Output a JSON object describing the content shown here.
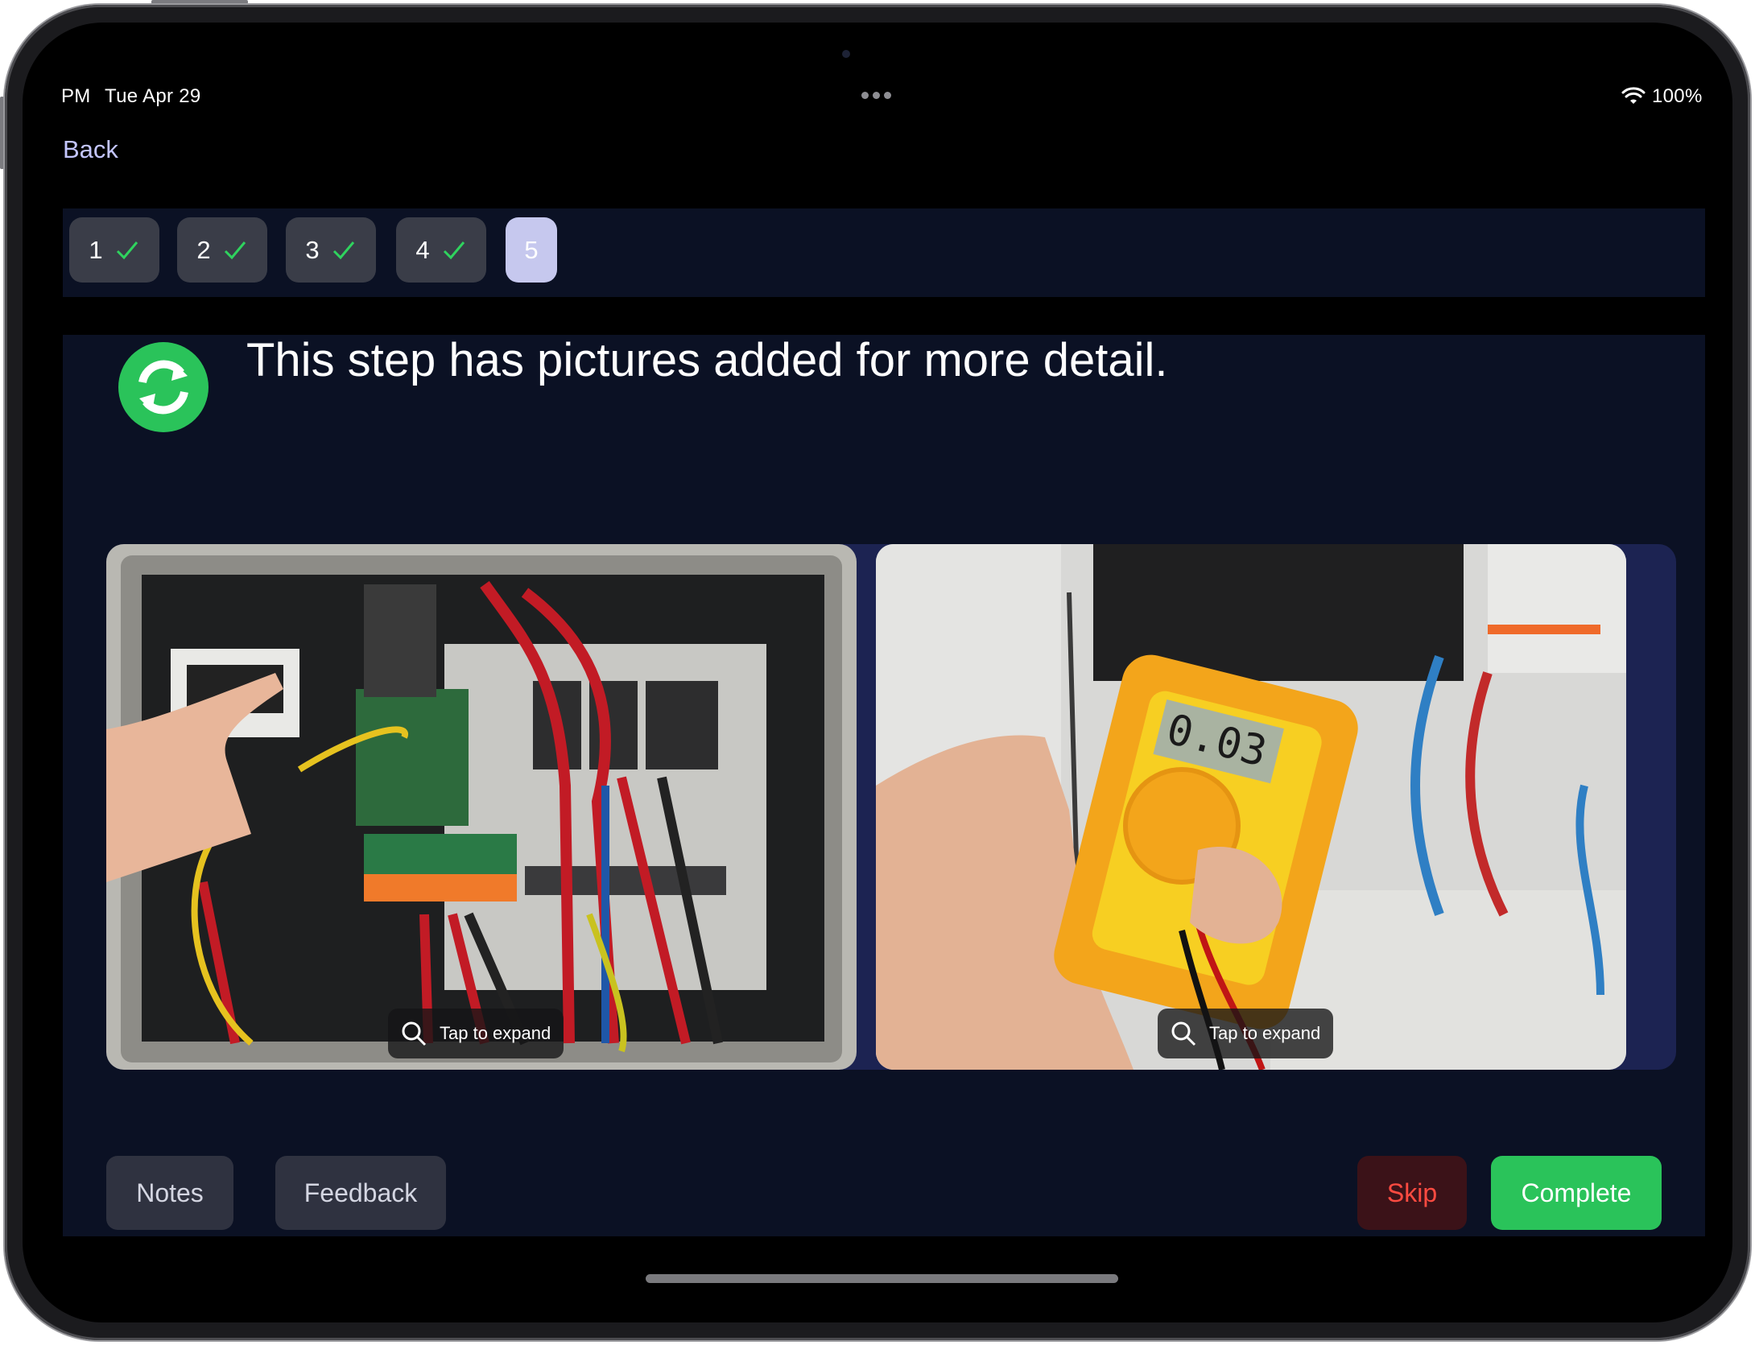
{
  "status_bar": {
    "time": "PM",
    "date": "Tue Apr 29",
    "battery": "100%"
  },
  "nav": {
    "back_label": "Back"
  },
  "steps": [
    {
      "label": "1",
      "done": true
    },
    {
      "label": "2",
      "done": true
    },
    {
      "label": "3",
      "done": true
    },
    {
      "label": "4",
      "done": true
    },
    {
      "label": "5",
      "done": false,
      "active": true
    }
  ],
  "step": {
    "title": "This step has pictures added for more detail."
  },
  "photos": [
    {
      "subject": "open electrical enclosure with a hand pointing at the breaker",
      "expand_label": "Tap to expand"
    },
    {
      "subject": "hand holding a yellow multimeter reading 0.03",
      "expand_label": "Tap to expand",
      "meter_reading": "0.03"
    }
  ],
  "actions": {
    "notes": "Notes",
    "feedback": "Feedback",
    "skip": "Skip",
    "complete": "Complete"
  },
  "colors": {
    "accent_green": "#2ac35a",
    "skip_red": "#ff4b41",
    "panel": "#0b1124",
    "active_step": "#c6c8ee"
  }
}
